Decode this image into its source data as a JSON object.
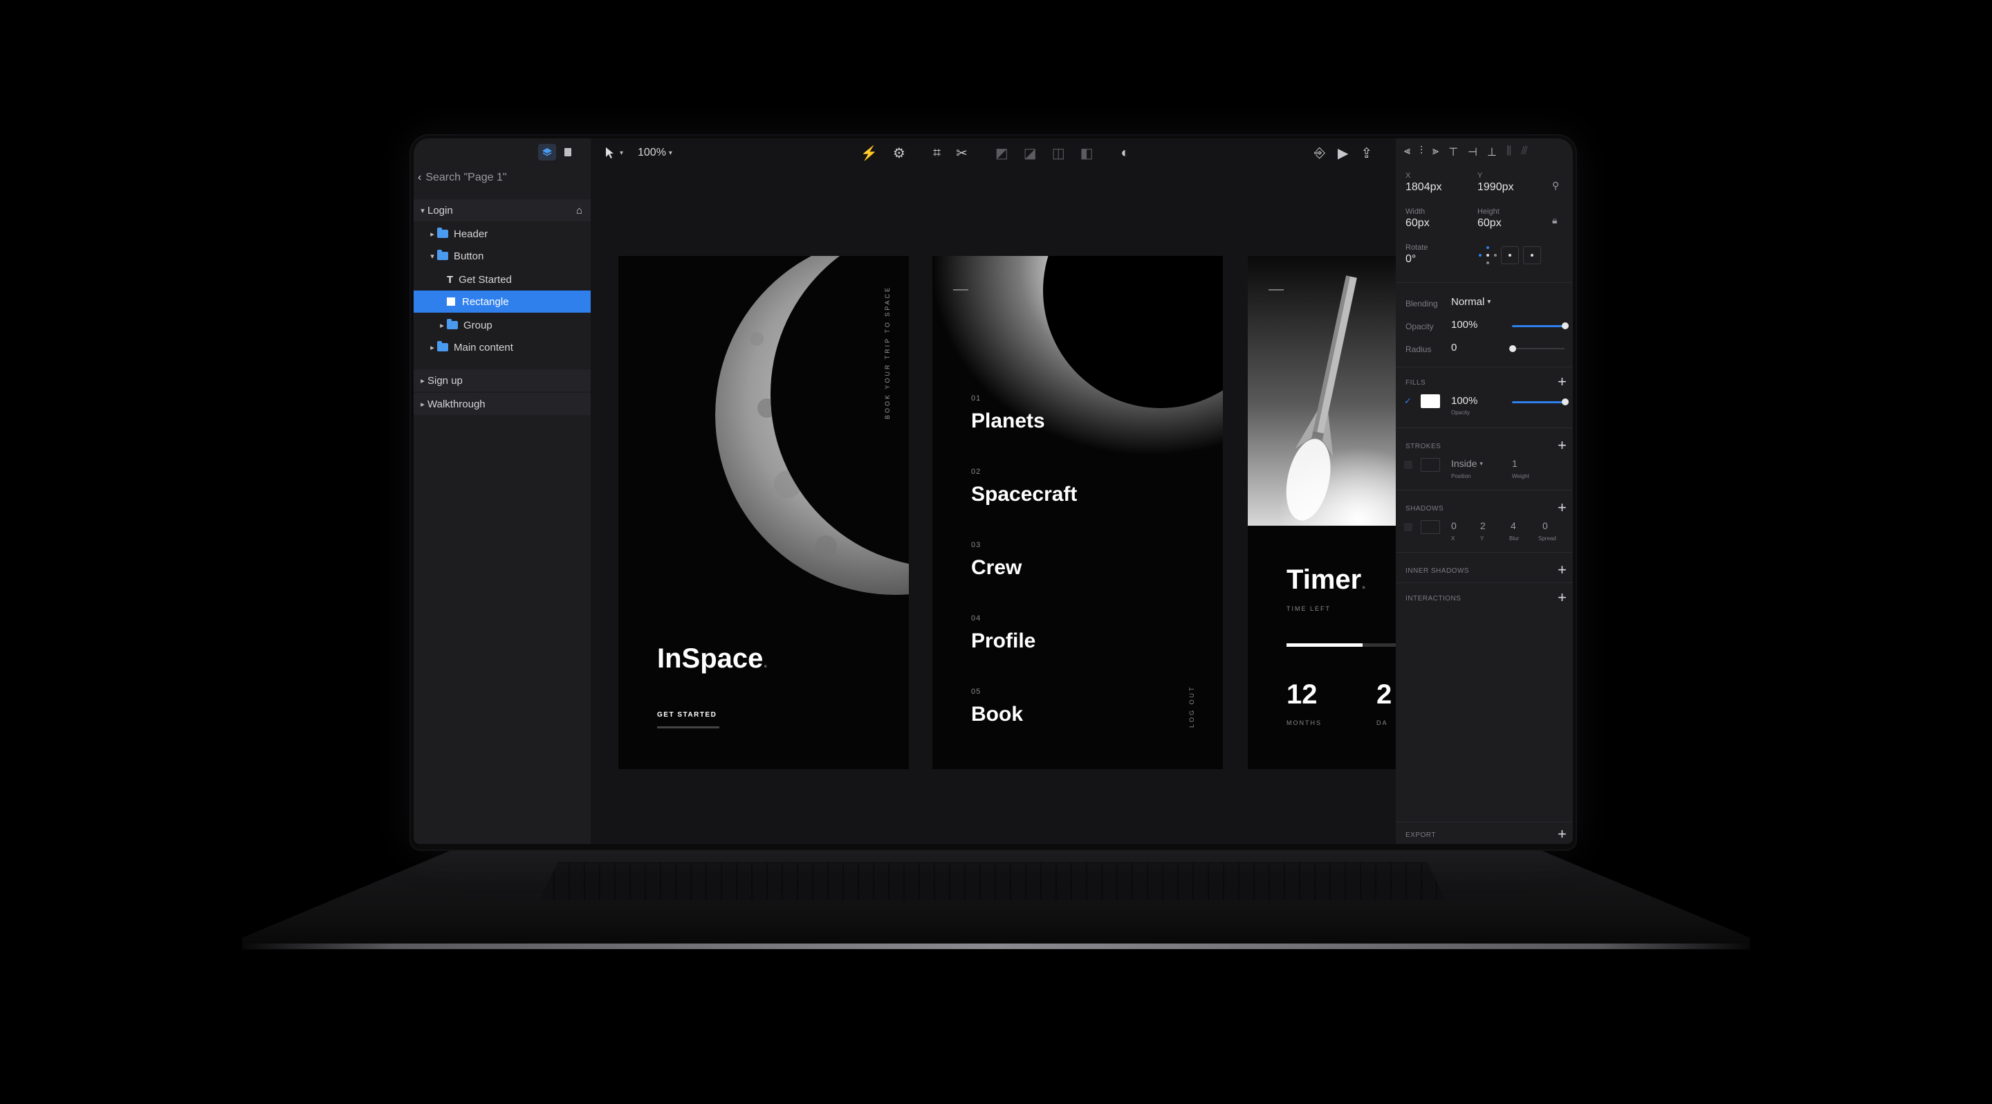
{
  "layers_panel": {
    "search_label": "Search \"Page 1\"",
    "tree": [
      {
        "label": "Login",
        "level": 0,
        "expanded": true,
        "type": "section"
      },
      {
        "label": "Header",
        "level": 1,
        "expanded": false,
        "type": "folder"
      },
      {
        "label": "Button",
        "level": 1,
        "expanded": true,
        "type": "folder"
      },
      {
        "label": "Get Started",
        "level": 2,
        "type": "text"
      },
      {
        "label": "Rectangle",
        "level": 2,
        "type": "rectangle",
        "selected": true
      },
      {
        "label": "Group",
        "level": 2,
        "expanded": false,
        "type": "folder"
      },
      {
        "label": "Main content",
        "level": 1,
        "expanded": false,
        "type": "folder"
      },
      {
        "label": "Sign up",
        "level": 0,
        "expanded": false,
        "type": "section"
      },
      {
        "label": "Walkthrough",
        "level": 0,
        "expanded": false,
        "type": "section"
      }
    ]
  },
  "toolbar": {
    "zoom": "100%"
  },
  "artboards": {
    "login": {
      "title": "InSpace",
      "vertical_text": "BOOK YOUR TRIP TO SPACE",
      "cta": "GET STARTED"
    },
    "menu": {
      "items": [
        {
          "num": "01",
          "label": "Planets"
        },
        {
          "num": "02",
          "label": "Spacecraft"
        },
        {
          "num": "03",
          "label": "Crew"
        },
        {
          "num": "04",
          "label": "Profile"
        },
        {
          "num": "05",
          "label": "Book"
        }
      ],
      "logout": "LOG OUT"
    },
    "timer": {
      "title": "Timer",
      "subtitle": "TIME LEFT",
      "value1": "12",
      "label1": "MONTHS",
      "value2": "2",
      "label2": "DA",
      "progress": 0.55
    }
  },
  "inspector": {
    "x_label": "X",
    "x_value": "1804px",
    "y_label": "Y",
    "y_value": "1990px",
    "width_label": "Width",
    "width_value": "60px",
    "height_label": "Height",
    "height_value": "60px",
    "rotate_label": "Rotate",
    "rotate_value": "0°",
    "blending_label": "Blending",
    "blending_value": "Normal",
    "opacity_label": "Opacity",
    "opacity_value": "100%",
    "radius_label": "Radius",
    "radius_value": "0",
    "fills_title": "FILLS",
    "fill_value": "100%",
    "fill_sublabel": "Opacity",
    "strokes_title": "STROKES",
    "stroke_position": "Inside",
    "stroke_position_label": "Position",
    "stroke_weight": "1",
    "stroke_weight_label": "Weight",
    "shadows_title": "SHADOWS",
    "shadow_x": "0",
    "shadow_x_label": "X",
    "shadow_y": "2",
    "shadow_y_label": "Y",
    "shadow_blur": "4",
    "shadow_blur_label": "Blur",
    "shadow_spread": "0",
    "shadow_spread_label": "Spread",
    "inner_shadows_title": "INNER SHADOWS",
    "interactions_title": "INTERACTIONS",
    "export_title": "EXPORT"
  },
  "colors": {
    "accent": "#2f80ed",
    "panel": "#1d1d20",
    "canvas": "#141416"
  }
}
